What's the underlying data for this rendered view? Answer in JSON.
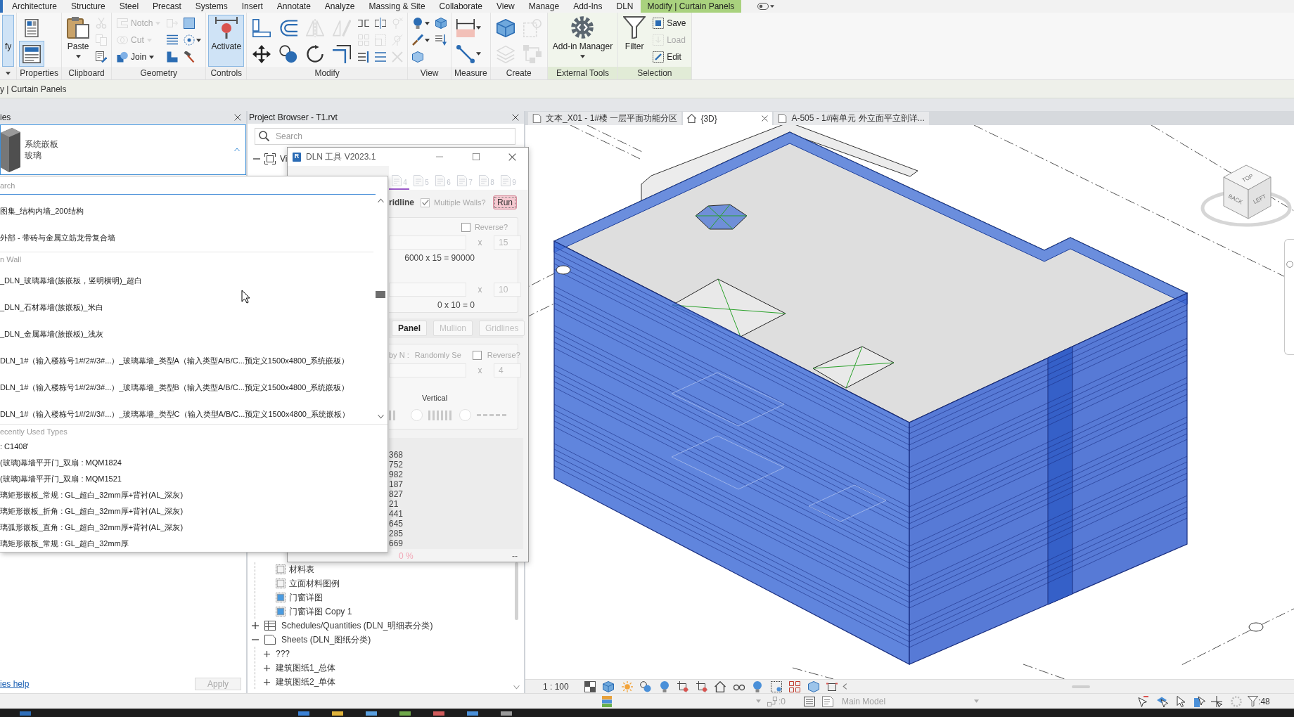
{
  "ribbon": {
    "tabs": [
      {
        "label": "Architecture",
        "selected": false
      },
      {
        "label": "Structure",
        "selected": false
      },
      {
        "label": "Steel",
        "selected": false
      },
      {
        "label": "Precast",
        "selected": false
      },
      {
        "label": "Systems",
        "selected": false
      },
      {
        "label": "Insert",
        "selected": false
      },
      {
        "label": "Annotate",
        "selected": false
      },
      {
        "label": "Analyze",
        "selected": false
      },
      {
        "label": "Massing & Site",
        "selected": false
      },
      {
        "label": "Collaborate",
        "selected": false
      },
      {
        "label": "View",
        "selected": false
      },
      {
        "label": "Manage",
        "selected": false
      },
      {
        "label": "Add-Ins",
        "selected": false
      },
      {
        "label": "DLN",
        "selected": false
      },
      {
        "label": "Modify | Curtain Panels",
        "selected": true
      }
    ],
    "panels": [
      {
        "expander": true,
        "contextual": false,
        "columns": [
          {
            "tools": [
              {
                "kind": "big",
                "label": "fy",
                "selected": true,
                "disabled": false,
                "dropdown": false
              }
            ]
          }
        ]
      },
      {
        "label": "Properties",
        "expander": false,
        "contextual": false,
        "columns": [
          {
            "tools": [
              {
                "kind": "medium",
                "selected": false,
                "disabled": false,
                "dropdown": false
              },
              {
                "kind": "medium",
                "selected": true,
                "disabled": false,
                "dropdown": false
              }
            ]
          }
        ]
      },
      {
        "label": "Clipboard",
        "expander": false,
        "contextual": false,
        "columns": [
          {
            "tools": [
              {
                "kind": "big",
                "label": "Paste",
                "selected": false,
                "disabled": false,
                "dropdown": true
              }
            ]
          },
          {
            "tools": [
              {
                "kind": "icon",
                "selected": false,
                "disabled": true,
                "dropdown": false
              },
              {
                "kind": "icon",
                "selected": false,
                "disabled": true,
                "dropdown": false
              },
              {
                "kind": "icon",
                "selected": false,
                "disabled": false,
                "dropdown": false
              }
            ]
          }
        ]
      },
      {
        "label": "Geometry",
        "expander": false,
        "contextual": false,
        "columns": [
          {
            "tools": [
              {
                "kind": "row",
                "label": "Notch",
                "selected": false,
                "disabled": true,
                "dropdown": true
              },
              {
                "kind": "row",
                "label": "Cut",
                "selected": false,
                "disabled": true,
                "dropdown": true
              },
              {
                "kind": "row",
                "label": "Join",
                "selected": false,
                "disabled": false,
                "dropdown": true
              }
            ]
          },
          {
            "tools": [
              {
                "kind": "icon",
                "selected": false,
                "disabled": true,
                "dropdown": false
              },
              {
                "kind": "icon",
                "selected": false,
                "disabled": false,
                "dropdown": false
              },
              {
                "kind": "icon",
                "selected": false,
                "disabled": false,
                "dropdown": false
              }
            ]
          },
          {
            "tools": [
              {
                "kind": "icon",
                "selected": false,
                "disabled": false,
                "dropdown": false
              },
              {
                "kind": "icon",
                "selected": false,
                "disabled": false,
                "dropdown": true
              },
              {
                "kind": "icon",
                "selected": false,
                "disabled": false,
                "dropdown": false
              }
            ]
          }
        ]
      },
      {
        "label": "Controls",
        "expander": false,
        "contextual": false,
        "columns": [
          {
            "tools": [
              {
                "kind": "big",
                "label": "Activate",
                "selected": true,
                "disabled": false,
                "dropdown": false
              }
            ]
          }
        ]
      },
      {
        "label": "Modify",
        "expander": false,
        "contextual": false,
        "columns": [
          {
            "tools": [
              {
                "kind": "medium",
                "selected": false,
                "disabled": false,
                "dropdown": false
              },
              {
                "kind": "medium",
                "selected": false,
                "disabled": false,
                "dropdown": false
              }
            ]
          },
          {
            "tools": [
              {
                "kind": "medium",
                "selected": false,
                "disabled": false,
                "dropdown": false
              },
              {
                "kind": "medium",
                "selected": false,
                "disabled": false,
                "dropdown": false
              }
            ]
          },
          {
            "tools": [
              {
                "kind": "medium",
                "selected": false,
                "disabled": true,
                "dropdown": false
              },
              {
                "kind": "medium",
                "selected": false,
                "disabled": false,
                "dropdown": false
              }
            ]
          },
          {
            "tools": [
              {
                "kind": "medium",
                "selected": false,
                "disabled": true,
                "dropdown": false
              },
              {
                "kind": "medium",
                "selected": false,
                "disabled": false,
                "dropdown": false
              }
            ]
          },
          {
            "tools": [
              {
                "kind": "icon",
                "selected": false,
                "disabled": false,
                "dropdown": false
              },
              {
                "kind": "icon",
                "selected": false,
                "disabled": true,
                "dropdown": false
              },
              {
                "kind": "icon",
                "selected": false,
                "disabled": false,
                "dropdown": false
              }
            ]
          },
          {
            "tools": [
              {
                "kind": "icon",
                "selected": false,
                "disabled": false,
                "dropdown": false
              },
              {
                "kind": "icon",
                "selected": false,
                "disabled": true,
                "dropdown": false
              },
              {
                "kind": "icon",
                "selected": false,
                "disabled": false,
                "dropdown": false
              }
            ]
          },
          {
            "tools": [
              {
                "kind": "icon",
                "selected": false,
                "disabled": true,
                "dropdown": false
              },
              {
                "kind": "icon",
                "selected": false,
                "disabled": true,
                "dropdown": false
              },
              {
                "kind": "icon",
                "selected": false,
                "disabled": true,
                "dropdown": false
              }
            ]
          }
        ]
      },
      {
        "label": "View",
        "expander": false,
        "contextual": false,
        "columns": [
          {
            "tools": [
              {
                "kind": "icon",
                "selected": false,
                "disabled": false,
                "dropdown": true
              },
              {
                "kind": "icon",
                "selected": false,
                "disabled": false,
                "dropdown": true
              },
              {
                "kind": "icon",
                "selected": false,
                "disabled": false,
                "dropdown": false
              }
            ]
          },
          {
            "tools": [
              {
                "kind": "icon",
                "selected": false,
                "disabled": false,
                "dropdown": false
              },
              {
                "kind": "icon",
                "selected": false,
                "disabled": false,
                "dropdown": false
              }
            ]
          }
        ]
      },
      {
        "label": "Measure",
        "expander": false,
        "contextual": false,
        "columns": [
          {
            "tools": [
              {
                "kind": "medium",
                "selected": false,
                "disabled": false,
                "dropdown": true
              },
              {
                "kind": "medium",
                "selected": false,
                "disabled": false,
                "dropdown": true
              }
            ]
          }
        ]
      },
      {
        "label": "Create",
        "expander": false,
        "contextual": false,
        "columns": [
          {
            "tools": [
              {
                "kind": "medium",
                "selected": false,
                "disabled": false,
                "dropdown": false
              },
              {
                "kind": "medium",
                "selected": false,
                "disabled": true,
                "dropdown": false
              }
            ]
          },
          {
            "tools": [
              {
                "kind": "medium",
                "selected": false,
                "disabled": true,
                "dropdown": false
              },
              {
                "kind": "medium",
                "selected": false,
                "disabled": true,
                "dropdown": false
              }
            ]
          }
        ]
      },
      {
        "label": "External Tools",
        "expander": false,
        "contextual": true,
        "columns": [
          {
            "tools": [
              {
                "kind": "big",
                "label": "Add-in Manager",
                "selected": false,
                "disabled": false,
                "dropdown": true
              }
            ]
          }
        ]
      },
      {
        "label": "Selection",
        "expander": false,
        "contextual": true,
        "columns": [
          {
            "tools": [
              {
                "kind": "big",
                "label": "Filter",
                "selected": false,
                "disabled": false,
                "dropdown": false
              }
            ]
          },
          {
            "tools": [
              {
                "kind": "row",
                "label": "Save",
                "selected": false,
                "disabled": false,
                "dropdown": false
              },
              {
                "kind": "row",
                "label": "Load",
                "selected": false,
                "disabled": true,
                "dropdown": false
              },
              {
                "kind": "row",
                "label": "Edit",
                "selected": false,
                "disabled": false,
                "dropdown": false
              }
            ]
          }
        ]
      }
    ]
  },
  "options_bar": {
    "context": "y | Curtain Panels"
  },
  "properties": {
    "title": "ies",
    "type": {
      "family": "系统嵌板",
      "name": "玻璃"
    },
    "help_link": "ies help",
    "apply": {
      "label": "Apply",
      "disabled": true
    }
  },
  "type_list": {
    "search": {
      "placeholder": "arch"
    },
    "groups": [
      {
        "kind": "types",
        "items": [
          {
            "label": "图集_结构内墙_200结构",
            "selected": false
          },
          {
            "label": "外部 - 带砖与金属立筋龙骨复合墙",
            "selected": false
          }
        ]
      },
      {
        "kind": "types",
        "header": "n Wall",
        "items": [
          {
            "label": "_DLN_玻璃幕墙(族嵌板，竖明横明)_超白",
            "selected": false
          },
          {
            "label": "_DLN_石材幕墙(族嵌板)_米白",
            "selected": false
          },
          {
            "label": "_DLN_金属幕墙(族嵌板)_浅灰",
            "selected": false
          },
          {
            "label": "DLN_1#（输入楼栋号1#/2#/3#...）_玻璃幕墙_类型A（输入类型A/B/C...预定义1500x4800_系统嵌板）",
            "selected": false
          },
          {
            "label": "DLN_1#（输入楼栋号1#/2#/3#...）_玻璃幕墙_类型B（输入类型A/B/C...预定义1500x4800_系统嵌板）",
            "selected": false
          },
          {
            "label": "DLN_1#（输入楼栋号1#/2#/3#...）_玻璃幕墙_类型C（输入类型A/B/C...预定义1500x4800_系统嵌板）",
            "selected": false
          }
        ]
      },
      {
        "kind": "recent",
        "header": "ecently Used Types",
        "items": [
          {
            "label": ": C1408'",
            "selected": false
          },
          {
            "label": "(玻璃)幕墙平开门_双扇 : MQM1824",
            "selected": false
          },
          {
            "label": "(玻璃)幕墙平开门_双扇 : MQM1521",
            "selected": false
          },
          {
            "label": "璃矩形嵌板_常规 : GL_超白_32mm厚+背衬(AL_深灰)",
            "selected": false
          },
          {
            "label": "璃矩形嵌板_折角 : GL_超白_32mm厚+背衬(AL_深灰)",
            "selected": false
          },
          {
            "label": "璃弧形嵌板_直角 : GL_超白_32mm厚+背衬(AL_深灰)",
            "selected": false
          },
          {
            "label": "璃矩形嵌板_常规 : GL_超白_32mm厚",
            "selected": false
          }
        ]
      }
    ]
  },
  "project_browser": {
    "title": "Project Browser - T1.rvt",
    "search": {
      "placeholder": "Search"
    },
    "top_items": [
      {
        "label": "Vi",
        "expanded": true
      }
    ],
    "legend_views": [
      {
        "label": "材料表",
        "kind": "blank"
      },
      {
        "label": "立面材料图例",
        "kind": "blank"
      },
      {
        "label": "门窗详图",
        "kind": "shaded"
      },
      {
        "label": "门窗详图 Copy 1",
        "kind": "shaded"
      }
    ],
    "sections": [
      {
        "label": "Schedules/Quantities (DLN_明细表分类)",
        "kind": "schedules",
        "expanded": false
      },
      {
        "label": "Sheets (DLN_图纸分类)",
        "kind": "sheets",
        "expanded": true,
        "children": [
          {
            "label": "???",
            "expanded": false
          },
          {
            "label": "建筑图纸1_总体",
            "expanded": false
          },
          {
            "label": "建筑图纸2_单体",
            "expanded": false
          }
        ]
      }
    ]
  },
  "dln_dialog": {
    "logo": "R",
    "title": "DLN 工具 V2023.1",
    "toolbar": [
      {
        "label": "4",
        "selected": true
      },
      {
        "label": "5",
        "selected": false
      },
      {
        "label": "6",
        "selected": false
      },
      {
        "label": "7",
        "selected": false
      },
      {
        "label": "8",
        "selected": false
      },
      {
        "label": "9",
        "selected": false
      }
    ],
    "mode_label": "ridline",
    "multiple_walls": {
      "label": "Multiple Walls?",
      "checked": true,
      "disabled": true
    },
    "run_button": {
      "label": "Run"
    },
    "grid_group": {
      "reverse": {
        "label": "Reverse?",
        "checked": false
      },
      "rows": [
        {
          "operator": "x",
          "count": "15",
          "result": "6000 x 15 = 90000"
        },
        {
          "operator": "x",
          "count": "10",
          "result": "0 x 10 = 0"
        }
      ]
    },
    "tabs": [
      {
        "label": "Panel",
        "selected": true,
        "disabled": false
      },
      {
        "label": "Mullion",
        "selected": false,
        "disabled": true
      },
      {
        "label": "Gridlines",
        "selected": false,
        "disabled": true
      }
    ],
    "panel_group": {
      "by_label": "by N :",
      "mode_label": "Randomly Se",
      "reverse": {
        "label": "Reverse?",
        "checked": false
      },
      "operator": "x",
      "count": "4",
      "direction_label": "Vertical",
      "patterns": [
        {
          "kind": "lines",
          "selected": false
        },
        {
          "kind": "dashes",
          "selected": false
        }
      ]
    },
    "output_lines": [
      "368",
      "752",
      "982",
      "187",
      "827",
      "21",
      "441",
      "645",
      "285",
      "669"
    ],
    "progress": "0 %",
    "status": "--"
  },
  "view": {
    "tabs": [
      {
        "label": "文本_X01 - 1#楼 一层平面功能分区",
        "kind": "plan",
        "selected": false
      },
      {
        "label": "{3D}",
        "kind": "model",
        "selected": true
      },
      {
        "label": "A-505 - 1#南单元 外立面平立剖详...",
        "kind": "sheet",
        "selected": false
      }
    ],
    "view_cube": {
      "faces": [
        "TOP",
        "BACK",
        "LEFT"
      ]
    },
    "scale": "1 : 100"
  },
  "status_bar": {
    "worksets": ":0",
    "model": {
      "label": "Main Model",
      "disabled": true
    },
    "filter_count": ":48"
  }
}
